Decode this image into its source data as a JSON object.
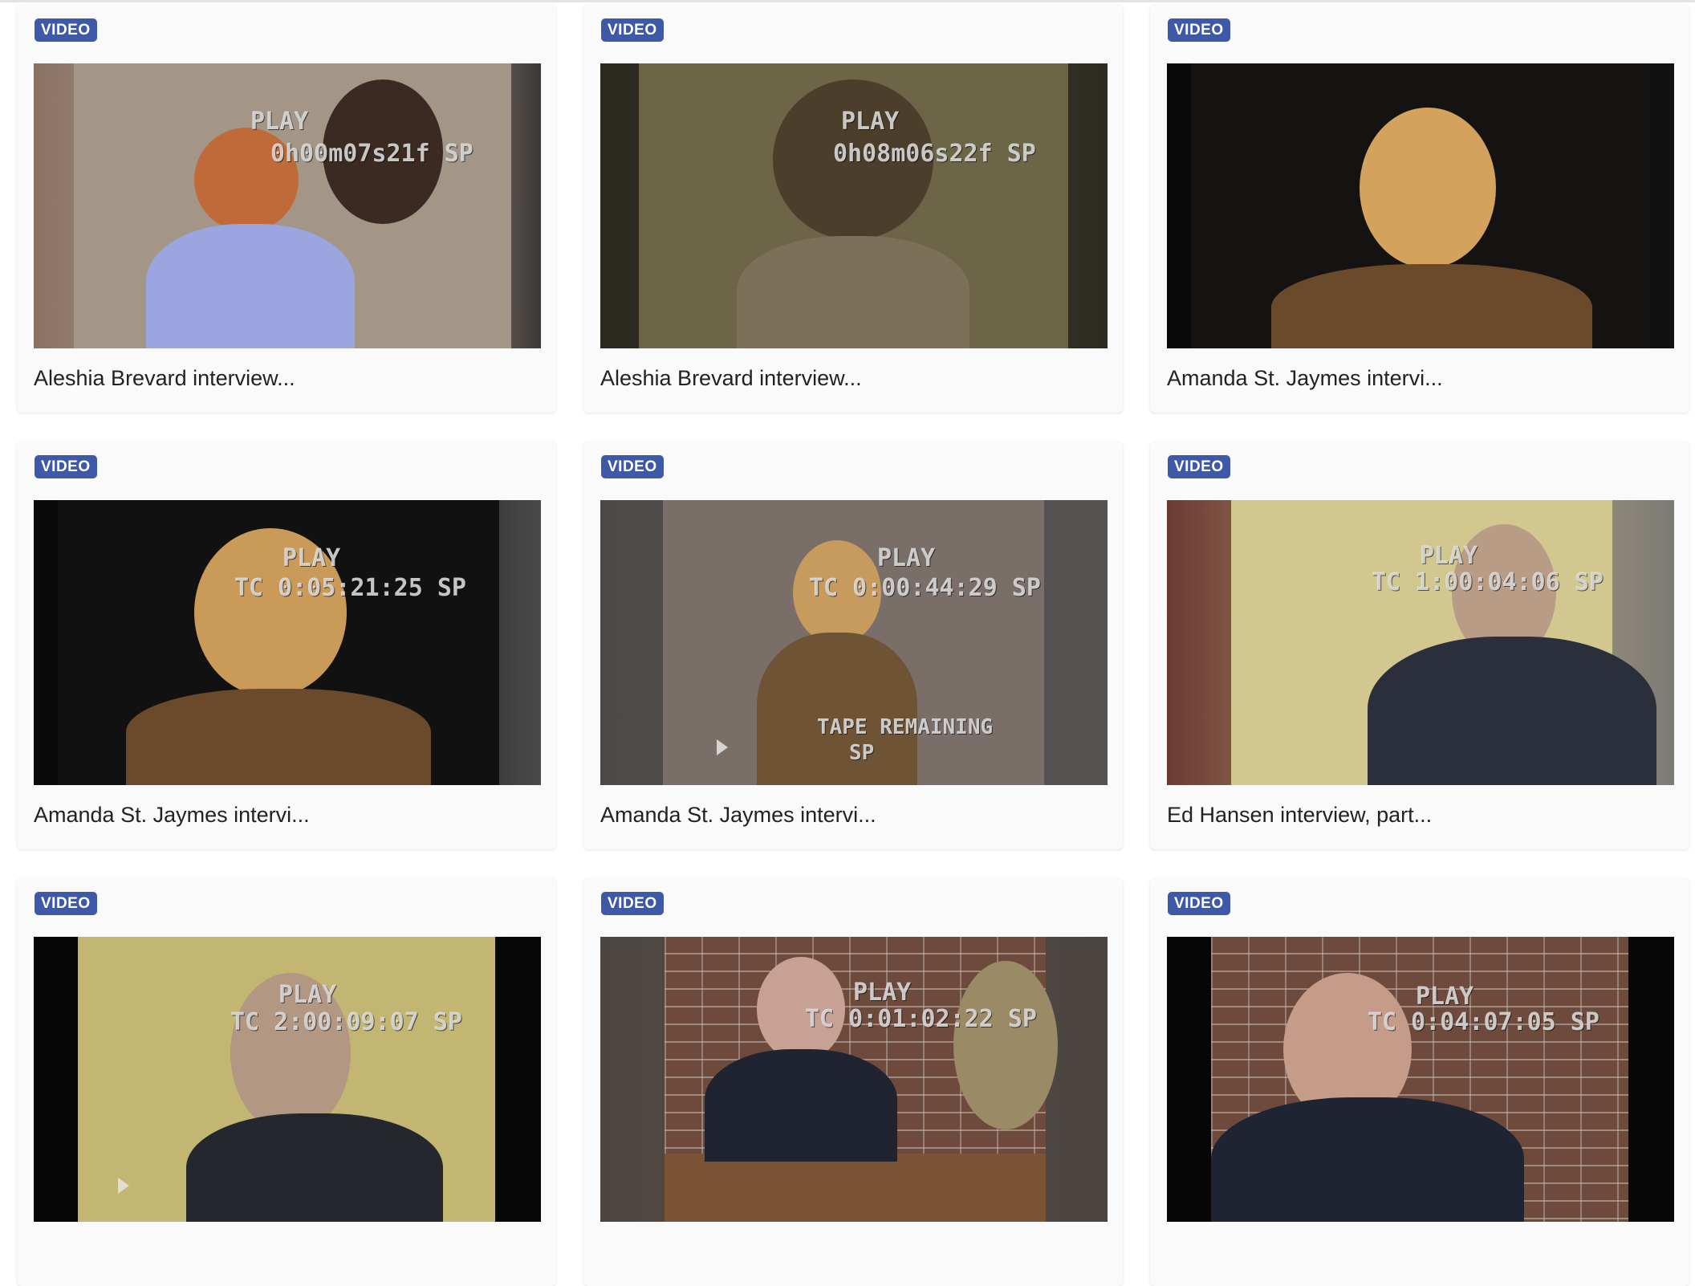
{
  "cards": [
    {
      "badge": "VIDEO",
      "title": "Aleshia Brevard interview...",
      "osd_line1": "PLAY",
      "osd_line2": "0h00m07s21f SP",
      "thumb": {
        "bg": "#b7a79a",
        "frame_left": "#8a7060",
        "frame_right": "#3b3836",
        "frame_center": "#a39686",
        "head": "#c06a3a",
        "body": "#9ba6e0"
      }
    },
    {
      "badge": "VIDEO",
      "title": "Aleshia Brevard interview...",
      "osd_line1": "PLAY",
      "osd_line2": "0h08m06s22f SP",
      "thumb": {
        "bg": "#3a372a",
        "frame_left": "#2a281f",
        "frame_right": "#2e2b22",
        "frame_center": "#6d6547",
        "head": "#4b3e2a",
        "body": "#7d7058"
      }
    },
    {
      "badge": "VIDEO",
      "title": "Amanda St. Jaymes intervi...",
      "osd_line1": "",
      "osd_line2": "",
      "thumb": {
        "bg": "#0d0c0c",
        "frame_left": "#090909",
        "frame_right": "#111111",
        "frame_center": "#141312",
        "head": "#d3a25c",
        "body": "#6b4a2c"
      }
    },
    {
      "badge": "VIDEO",
      "title": "Amanda St. Jaymes intervi...",
      "osd_line1": "PLAY",
      "osd_line2": "TC 0:05:21:25 SP",
      "thumb": {
        "bg": "#0c0b0b",
        "frame_left": "#0a0a0a",
        "frame_right": "#4a4a4a",
        "frame_center": "#121111",
        "head": "#c99a58",
        "body": "#6b4a2c"
      }
    },
    {
      "badge": "VIDEO",
      "title": "Amanda St. Jaymes intervi...",
      "osd_line1": "PLAY",
      "osd_line2": "TC 0:00:44:29 SP",
      "osd_line3": "TAPE REMAINING",
      "osd_line4": "SP",
      "thumb": {
        "bg": "#57524f",
        "frame_left": "#4c4a49",
        "frame_right": "#545150",
        "frame_center": "#7a6e68",
        "head": "#c79a5e",
        "body": "#6f5335"
      }
    },
    {
      "badge": "VIDEO",
      "title": "Ed Hansen interview, part...",
      "osd_line1": "PLAY",
      "osd_line2": "TC 1:00:04:06 SP",
      "thumb": {
        "bg": "#cbbf86",
        "frame_left": "#6c3a33",
        "frame_right": "#7d7a75",
        "frame_center": "#d2c78f",
        "head": "#b89c86",
        "body": "#2b2f3b"
      }
    },
    {
      "badge": "VIDEO",
      "title": "",
      "osd_line1": "PLAY",
      "osd_line2": "TC 2:00:09:07 SP",
      "thumb": {
        "bg": "#0b0b0b",
        "frame_left": "#050505",
        "frame_right": "#070707",
        "frame_center": "#c3b673",
        "head": "#b29782",
        "body": "#25272e"
      }
    },
    {
      "badge": "VIDEO",
      "title": "",
      "osd_line1": "PLAY",
      "osd_line2": "TC 0:01:02:22 SP",
      "thumb": {
        "bg": "#5a4c44",
        "frame_left": "#4c4642",
        "frame_right": "#4a4541",
        "frame_center": "#6e4a3c",
        "head": "#c7a294",
        "body": "#1f2430"
      }
    },
    {
      "badge": "VIDEO",
      "title": "",
      "osd_line1": "PLAY",
      "osd_line2": "TC 0:04:07:05 SP",
      "thumb": {
        "bg": "#0a0a0a",
        "frame_left": "#050505",
        "frame_right": "#080808",
        "frame_center": "#6a4a3d",
        "head": "#c59c8a",
        "body": "#1e2431"
      }
    }
  ]
}
